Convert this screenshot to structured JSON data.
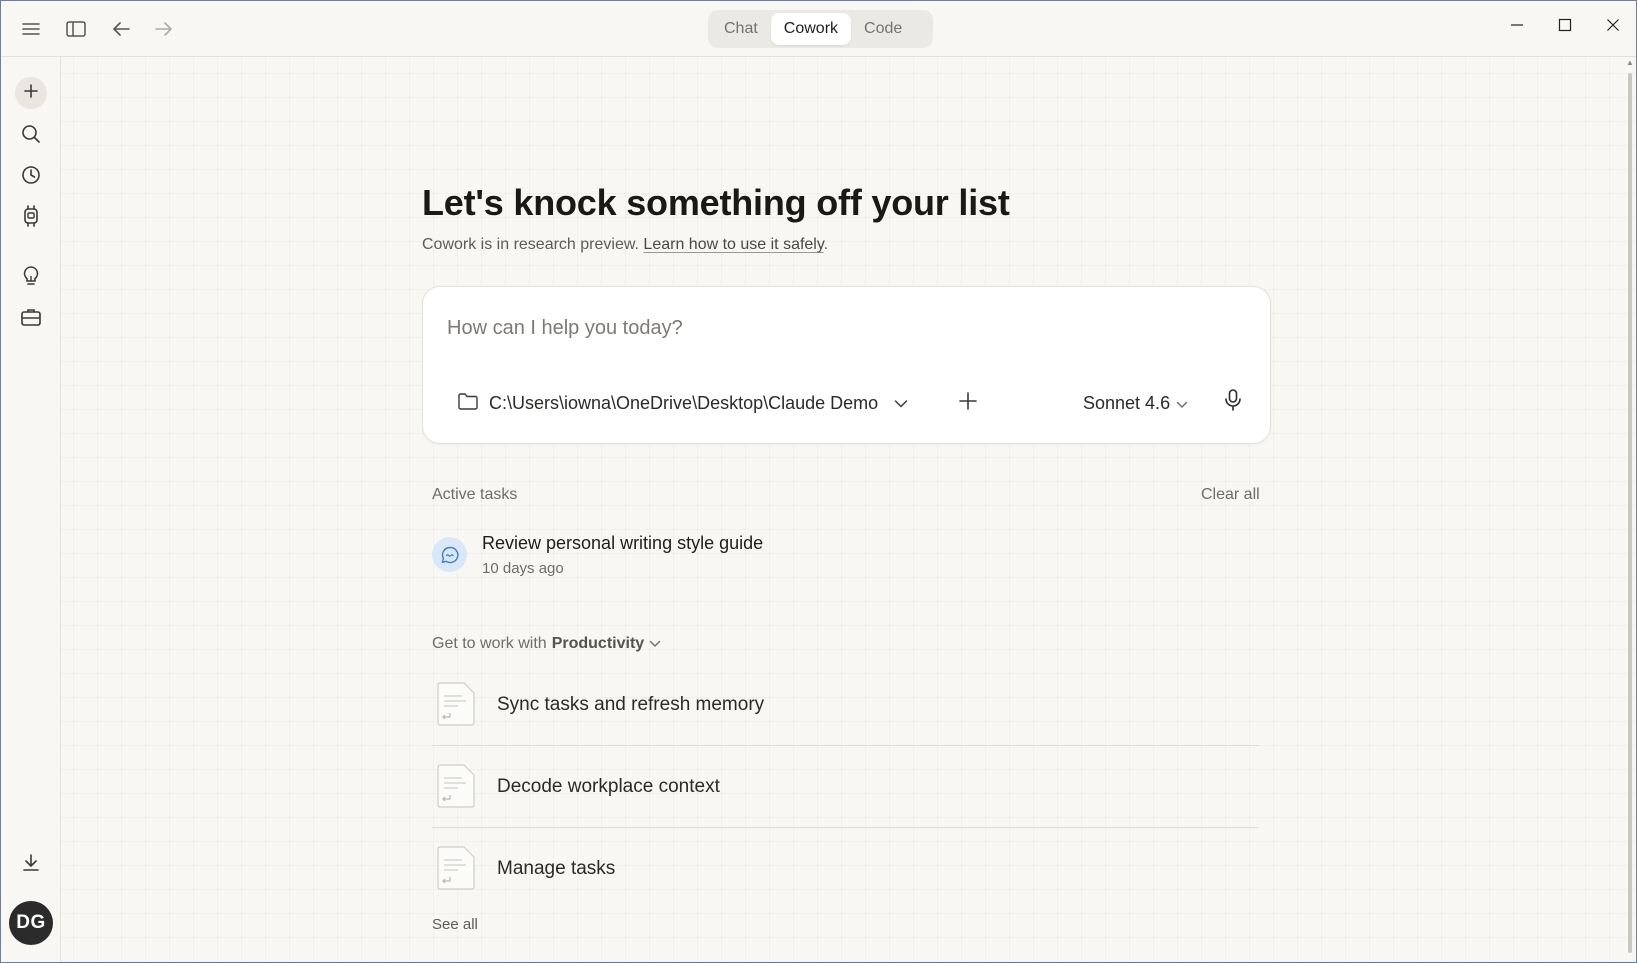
{
  "titlebar": {
    "modes": [
      {
        "label": "Chat",
        "active": false
      },
      {
        "label": "Cowork",
        "active": true
      },
      {
        "label": "Code",
        "active": false
      }
    ]
  },
  "rail": {
    "avatar_initials": "DG"
  },
  "main": {
    "headline": "Let's knock something off your list",
    "subline_text": "Cowork is in research preview.",
    "subline_link": "Learn how to use it safely",
    "subline_end": "."
  },
  "composer": {
    "placeholder": "How can I help you today?",
    "folder_path": "C:\\Users\\iowna\\OneDrive\\Desktop\\Claude Demo",
    "model": "Sonnet 4.6"
  },
  "active_tasks": {
    "label": "Active tasks",
    "clear_all": "Clear all",
    "items": [
      {
        "title": "Review personal writing style guide",
        "time": "10 days ago"
      }
    ]
  },
  "suggestions": {
    "prefix": "Get to work with",
    "category": "Productivity",
    "items": [
      {
        "label": "Sync tasks and refresh memory"
      },
      {
        "label": "Decode workplace context"
      },
      {
        "label": "Manage tasks"
      }
    ],
    "see_all": "See all"
  }
}
